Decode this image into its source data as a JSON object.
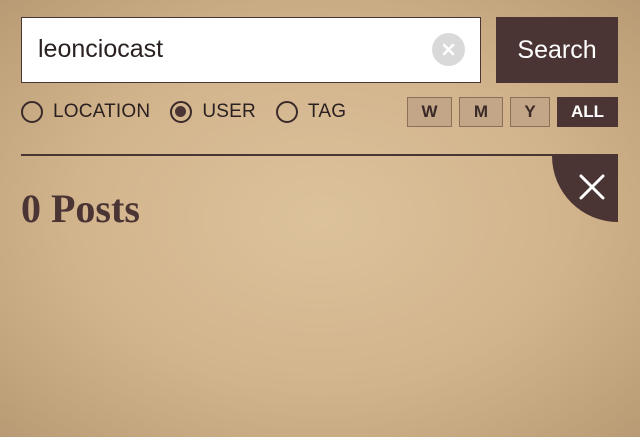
{
  "search": {
    "value": "leonciocast",
    "button_label": "Search",
    "clear_icon": "clear-x-icon"
  },
  "filters": {
    "types": [
      {
        "label": "LOCATION",
        "checked": false
      },
      {
        "label": "USER",
        "checked": true
      },
      {
        "label": "TAG",
        "checked": false
      }
    ],
    "periods": [
      {
        "label": "W",
        "active": false
      },
      {
        "label": "M",
        "active": false
      },
      {
        "label": "Y",
        "active": false
      },
      {
        "label": "ALL",
        "active": true
      }
    ]
  },
  "results": {
    "count_label": "0 Posts",
    "close_icon": "close-icon"
  },
  "colors": {
    "accent": "#4b3434",
    "background": "#d4b68f",
    "period_button": "#c2a687"
  }
}
